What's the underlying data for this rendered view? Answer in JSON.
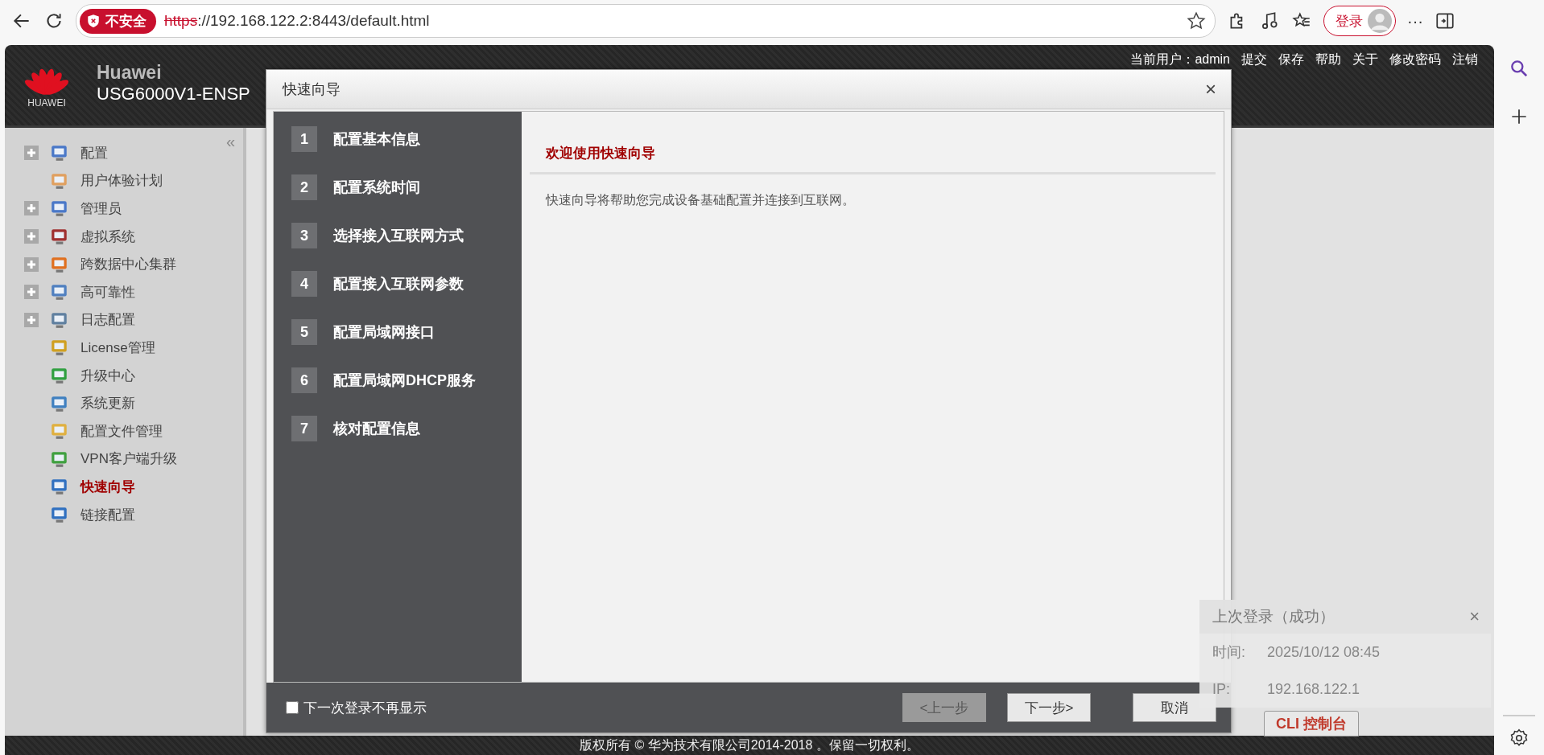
{
  "browser": {
    "security_badge": "不安全",
    "url_scheme": "https",
    "url_rest": "://192.168.122.2:8443/default.html",
    "login": "登录",
    "more": "···"
  },
  "app_header": {
    "logo_text": "HUAWEI",
    "brand": "Huawei",
    "model": "USG6000V1-ENSP",
    "links": [
      "当前用户：admin",
      "提交",
      "保存",
      "帮助",
      "关于",
      "修改密码",
      "注销"
    ]
  },
  "nav": {
    "collapse": "«",
    "items": [
      {
        "label": "配置",
        "expandable": true,
        "selected": false
      },
      {
        "label": "用户体验计划",
        "expandable": false,
        "selected": false
      },
      {
        "label": "管理员",
        "expandable": true,
        "selected": false
      },
      {
        "label": "虚拟系统",
        "expandable": true,
        "selected": false
      },
      {
        "label": "跨数据中心集群",
        "expandable": true,
        "selected": false
      },
      {
        "label": "高可靠性",
        "expandable": true,
        "selected": false
      },
      {
        "label": "日志配置",
        "expandable": true,
        "selected": false
      },
      {
        "label": "License管理",
        "expandable": false,
        "selected": false
      },
      {
        "label": "升级中心",
        "expandable": false,
        "selected": false
      },
      {
        "label": "系统更新",
        "expandable": false,
        "selected": false
      },
      {
        "label": "配置文件管理",
        "expandable": false,
        "selected": false
      },
      {
        "label": "VPN客户端升级",
        "expandable": false,
        "selected": false
      },
      {
        "label": "快速向导",
        "expandable": false,
        "selected": true
      },
      {
        "label": "链接配置",
        "expandable": false,
        "selected": false
      }
    ]
  },
  "dialog": {
    "title": "快速向导",
    "close": "×",
    "steps": [
      {
        "number": "1",
        "label": "配置基本信息"
      },
      {
        "number": "2",
        "label": "配置系统时间"
      },
      {
        "number": "3",
        "label": "选择接入互联网方式"
      },
      {
        "number": "4",
        "label": "配置接入互联网参数"
      },
      {
        "number": "5",
        "label": "配置局域网接口"
      },
      {
        "number": "6",
        "label": "配置局域网DHCP服务"
      },
      {
        "number": "7",
        "label": "核对配置信息"
      }
    ],
    "heading": "欢迎使用快速向导",
    "message": "快速向导将帮助您完成设备基础配置并连接到互联网。",
    "checkbox": {
      "label": "下一次登录不再显示",
      "checked": false
    },
    "buttons": [
      {
        "label": "<上一步",
        "disabled": true
      },
      {
        "label": "下一步>",
        "disabled": false
      },
      {
        "label": "取消",
        "disabled": false
      }
    ]
  },
  "footer": {
    "copyright": "版权所有 © 华为技术有限公司2014-2018 。保留一切权利。"
  },
  "cli_button": "CLI 控制台",
  "popup": {
    "title": "上次登录（成功）",
    "close": "×",
    "rows": [
      {
        "label": "时间:",
        "value": "2025/10/12 08:45"
      },
      {
        "label": "IP:",
        "value": "192.168.122.1"
      }
    ]
  }
}
